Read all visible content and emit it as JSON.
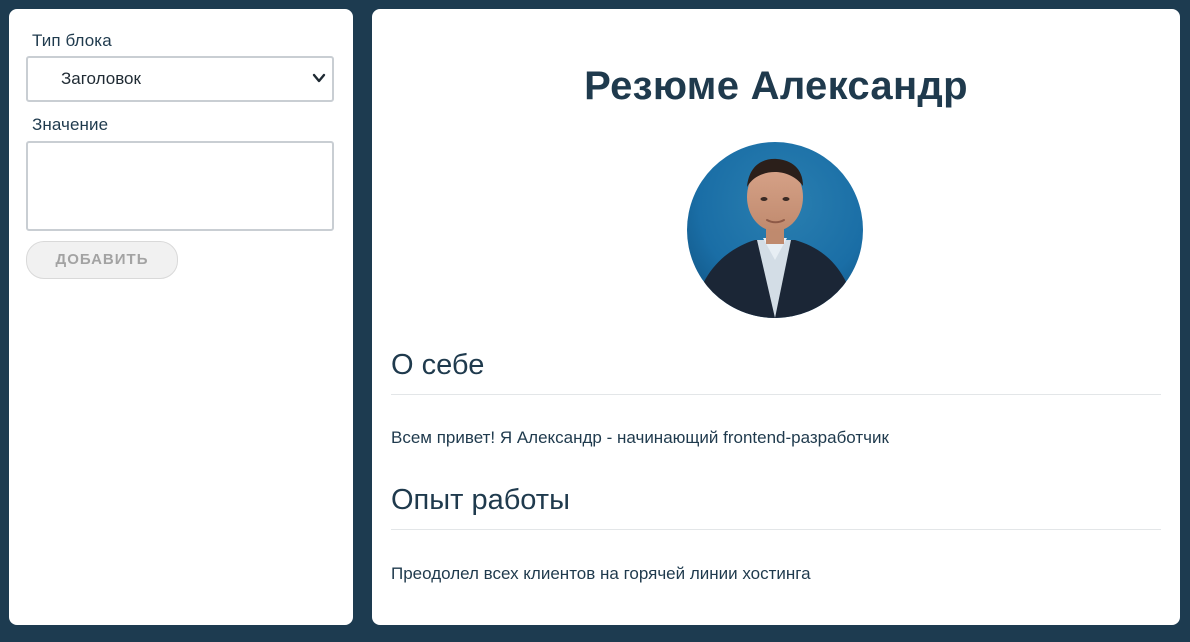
{
  "editor": {
    "type_label": "Тип блока",
    "type_select": {
      "selected": "Заголовок"
    },
    "value_label": "Значение",
    "value_field": {
      "value": "",
      "placeholder": ""
    },
    "add_button_label": "ДОБАВИТЬ"
  },
  "resume": {
    "title": "Резюме Александр",
    "sections": [
      {
        "heading": "О себе",
        "text": "Всем привет! Я Александр - начинающий frontend-разработчик"
      },
      {
        "heading": "Опыт работы",
        "text": "Преодолел всех клиентов на горячей линии хостинга"
      }
    ]
  },
  "colors": {
    "background": "#1d3b50",
    "text": "#1f3a4d",
    "panel": "#ffffff",
    "button_disabled_text": "#a3a3a3"
  },
  "icons": {
    "select_arrow": "chevron-down-icon",
    "avatar": "profile-photo"
  }
}
